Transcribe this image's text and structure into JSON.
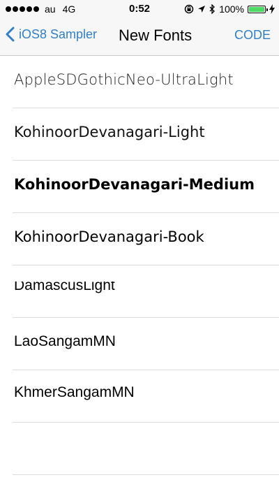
{
  "status_bar": {
    "carrier": "au",
    "network": "4G",
    "time": "0:52",
    "battery": "100%",
    "battery_color": "#4cd964"
  },
  "nav": {
    "back_label": "iOS8 Sampler",
    "title": "New Fonts",
    "code_label": "CODE",
    "accent_color": "#2f7fcb"
  },
  "fonts": [
    {
      "name": "AppleSDGothicNeo-UltraLight"
    },
    {
      "name": "KohinoorDevanagari-Light"
    },
    {
      "name": "KohinoorDevanagari-Medium"
    },
    {
      "name": "KohinoorDevanagari-Book"
    },
    {
      "name": "DamascusLight"
    },
    {
      "name": "LaoSangamMN"
    },
    {
      "name": "KhmerSangamMN"
    }
  ],
  "icons": {
    "signal": "signal-dots-icon",
    "lock": "rotation-lock-icon",
    "location": "location-arrow-icon",
    "bluetooth": "bluetooth-icon",
    "battery": "battery-icon",
    "charging": "charging-bolt-icon",
    "back": "chevron-left-icon"
  }
}
